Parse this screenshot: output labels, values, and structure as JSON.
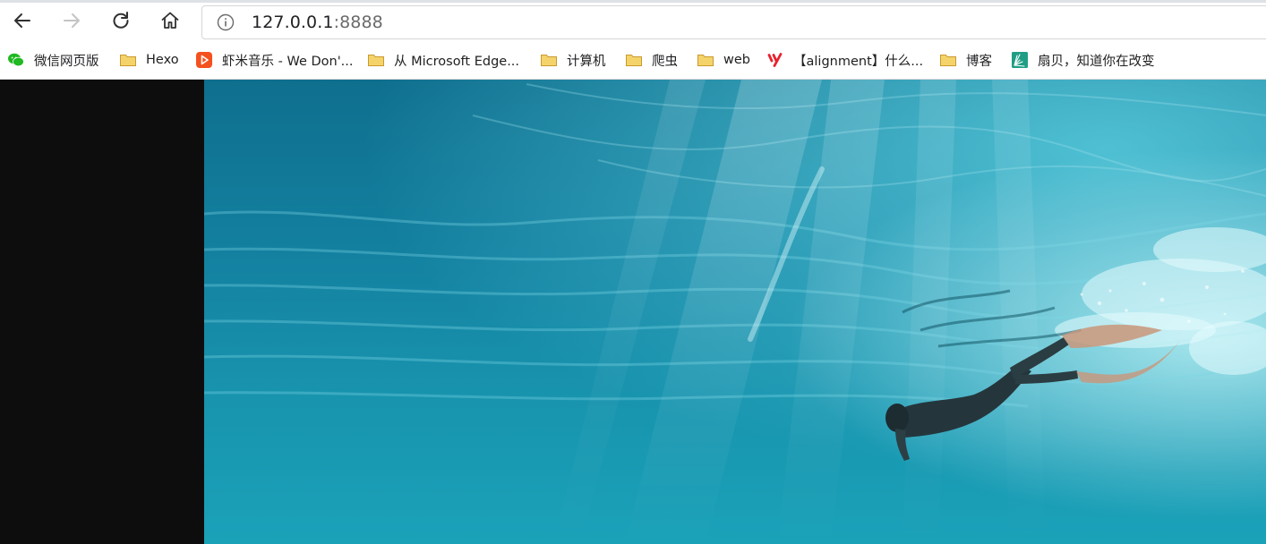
{
  "toolbar": {
    "back_icon": "arrow-left-icon",
    "forward_icon": "arrow-right-icon",
    "reload_icon": "reload-icon",
    "home_icon": "home-icon",
    "info_icon": "info-icon",
    "url_host": "127.0.0.1",
    "url_port": ":8888"
  },
  "bookmarks": [
    {
      "label": "微信网页版",
      "icon": "wechat-icon"
    },
    {
      "label": "Hexo",
      "icon": "folder-icon"
    },
    {
      "label": "虾米音乐 - We Don'...",
      "icon": "xiami-icon"
    },
    {
      "label": "从 Microsoft Edge...",
      "icon": "folder-icon"
    },
    {
      "label": "计算机",
      "icon": "folder-icon"
    },
    {
      "label": "爬虫",
      "icon": "folder-icon"
    },
    {
      "label": "web",
      "icon": "folder-icon"
    },
    {
      "label": "【alignment】什么...",
      "icon": "youdao-icon"
    },
    {
      "label": "博客",
      "icon": "folder-icon"
    },
    {
      "label": "扇贝，知道你在改变",
      "icon": "shanbay-icon"
    }
  ],
  "page": {
    "image_subject": "underwater-freediver-photo"
  },
  "colors": {
    "dark_panel": "#0d0d0d",
    "ocean_deep": "#0f6f8e",
    "ocean_light": "#1aa2b9",
    "folder_fill": "#f5d36b",
    "folder_stroke": "#c99a2e"
  }
}
